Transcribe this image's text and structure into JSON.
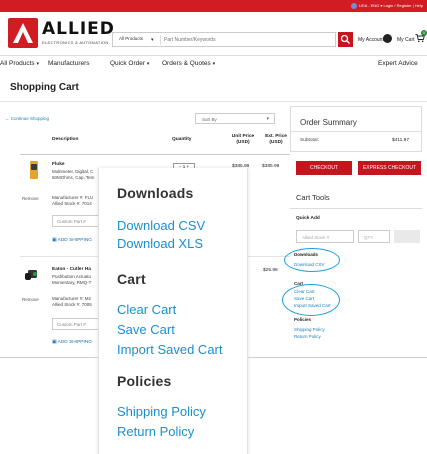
{
  "utility": {
    "region": "USA - ENG",
    "login": "Login / Register | Help"
  },
  "brand": {
    "name": "ALLIED",
    "tagline": "ELECTRONICS & AUTOMATION"
  },
  "search": {
    "scope": "All Products",
    "placeholder": "Part Number/Keywords"
  },
  "account": {
    "my_account": "My Account",
    "my_cart": "My Cart",
    "cart_count": "0"
  },
  "nav": {
    "all_products": "All Products",
    "manufacturers": "Manufacturers",
    "quick_order": "Quick Order",
    "orders_quotes": "Orders & Quotes",
    "expert_advice": "Expert Advice"
  },
  "page": {
    "title": "Shopping Cart",
    "continue": "Continue Shopping",
    "sort": "Sort By"
  },
  "table": {
    "description": "Description",
    "quantity": "Quantity",
    "unit_price": "Unit Price\n(USD)",
    "ext_price": "Ext. Price\n(USD)"
  },
  "items": [
    {
      "title": "Fluke",
      "desc1": "Multimeter, Digital, C",
      "desc2": "50MOhms, Cap, Tem",
      "remove": "Remove",
      "mfg1": "Manufacturer #: FLU",
      "mfg2": "Allied Stock #: 7014",
      "custom": "Custom Part #",
      "add_ship": "ADD SHIPPING",
      "qty": "1",
      "unit_price": "$385.99",
      "ext_price": "$385.99"
    },
    {
      "title": "Eaton - Cutler Ha",
      "desc1": "Pushbutton Actuato",
      "desc2": "Momentary, RMQ-T",
      "remove": "Remove",
      "mfg1": "Manufacturer #: M2",
      "mfg2": "Allied Stock #: 7005",
      "custom": "Custom Part #",
      "add_ship": "ADD SHIPPING",
      "ext_price": "$25.98"
    }
  ],
  "summary": {
    "title": "Order Summary",
    "subtotal_label": "Subtotal:",
    "subtotal": "$411.97",
    "checkout": "CHECKOUT",
    "express": "EXPRESS CHECKOUT"
  },
  "tools": {
    "title": "Cart Tools",
    "quick_add": "Quick Add",
    "stock_placeholder": "Allied Stock #",
    "qty_placeholder": "QTY",
    "downloads": "Downloads",
    "download_csv": "Download CSV",
    "download_xls_partial": "Download XLS",
    "cart": "Cart",
    "clear_cart": "Clear Cart",
    "save_cart": "Save Cart",
    "import_cart": "Import Saved Cart",
    "policies": "Policies",
    "shipping_policy": "Shipping Policy",
    "return_policy": "Return Policy"
  },
  "zoom": {
    "downloads": "Downloads",
    "download_csv": "Download CSV",
    "download_xls": "Download XLS",
    "cart": "Cart",
    "clear_cart": "Clear Cart",
    "save_cart": "Save Cart",
    "import_cart": "Import Saved Cart",
    "policies": "Policies",
    "shipping_policy": "Shipping Policy",
    "return_policy": "Return Policy"
  },
  "colors": {
    "brand_red": "#d01c22",
    "link_blue": "#1a8fd0",
    "highlight": "#1a9fdc"
  }
}
